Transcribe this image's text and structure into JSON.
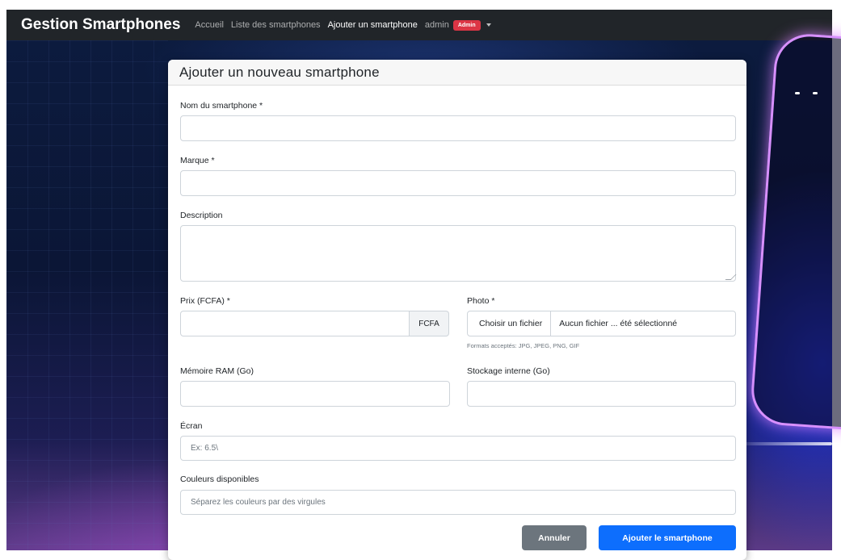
{
  "navbar": {
    "brand": "Gestion Smartphones",
    "links": [
      "Accueil",
      "Liste des smartphones",
      "Ajouter un smartphone"
    ],
    "user": "admin",
    "role_badge": "Admin"
  },
  "form": {
    "title": "Ajouter un nouveau smartphone",
    "name_label": "Nom du smartphone *",
    "name_value": "",
    "brand_label": "Marque *",
    "brand_value": "",
    "description_label": "Description",
    "description_value": "",
    "price_label": "Prix (FCFA) *",
    "price_value": "",
    "price_addon": "FCFA",
    "photo_label": "Photo *",
    "photo_button": "Choisir un fichier",
    "photo_filename": "Aucun fichier ... été sélectionné",
    "photo_help": "Formats acceptés: JPG, JPEG, PNG, GIF",
    "ram_label": "Mémoire RAM (Go)",
    "ram_value": "",
    "storage_label": "Stockage interne (Go)",
    "storage_value": "",
    "screen_label": "Écran",
    "screen_placeholder": "Ex: 6.5\\",
    "colors_label": "Couleurs disponibles",
    "colors_placeholder": "Séparez les couleurs par des virgules",
    "cancel_button": "Annuler",
    "submit_button": "Ajouter le smartphone"
  },
  "colors": {
    "navbar_bg": "#212529",
    "badge_bg": "#dc3545",
    "primary": "#0d6efd",
    "secondary": "#6c757d"
  }
}
